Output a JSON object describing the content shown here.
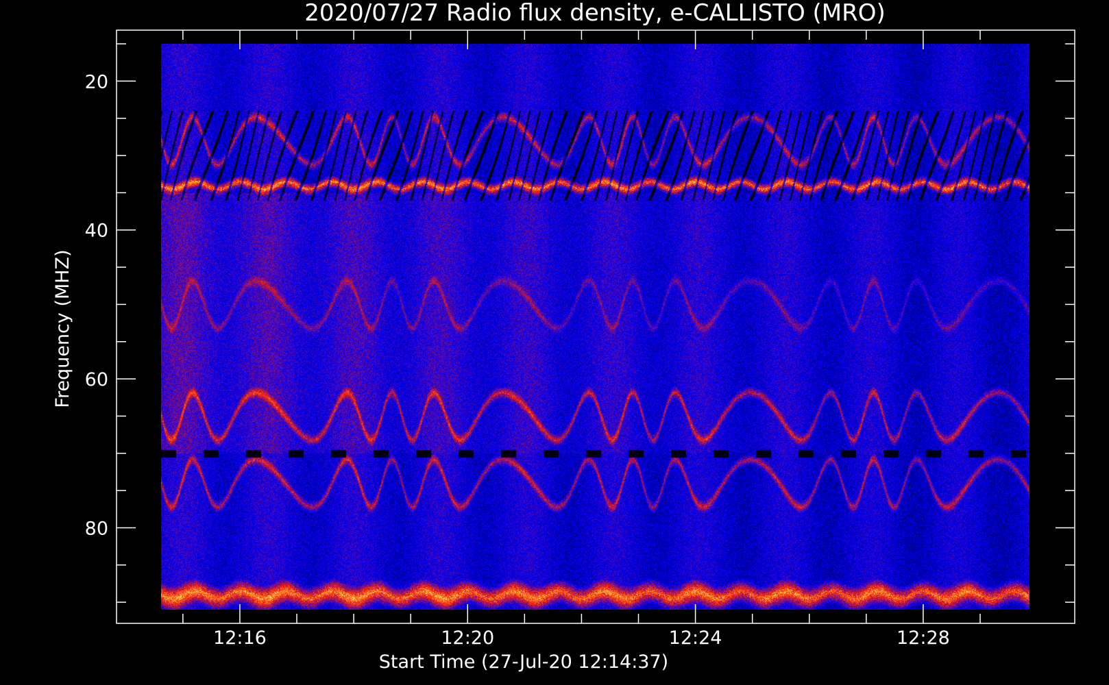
{
  "chart_data": {
    "type": "heatmap",
    "title": "2020/07/27  Radio flux density, e-CALLISTO (MRO)",
    "xlabel": "Start Time (27-Jul-20 12:14:37)",
    "ylabel": "Frequency (MHZ)",
    "x_axis": {
      "unit": "time",
      "range": [
        "12:14:37",
        "12:29:52"
      ],
      "ticks": [
        "12:16",
        "12:20",
        "12:24",
        "12:28"
      ],
      "minor_tick_interval_minutes": 1
    },
    "y_axis": {
      "unit": "MHz",
      "range": [
        15,
        91
      ],
      "inverted": true,
      "ticks": [
        20,
        40,
        60,
        80
      ],
      "minor_tick_interval": 5
    },
    "colormap": [
      "#000000",
      "#0000ff",
      "#ff2000",
      "#ffff60"
    ],
    "features": [
      {
        "type": "bright band",
        "freq_mhz": 34,
        "intensity": "high"
      },
      {
        "type": "wavy band",
        "freq_mhz": 28,
        "intensity": "medium"
      },
      {
        "type": "wavy band",
        "freq_mhz": 50,
        "intensity": "low"
      },
      {
        "type": "wavy band",
        "freq_mhz": 65,
        "intensity": "medium"
      },
      {
        "type": "wavy band",
        "freq_mhz": 74,
        "intensity": "medium"
      },
      {
        "type": "dashed dark line",
        "freq_mhz": 70
      },
      {
        "type": "bright noise",
        "freq_mhz": 89,
        "intensity": "high"
      }
    ]
  }
}
